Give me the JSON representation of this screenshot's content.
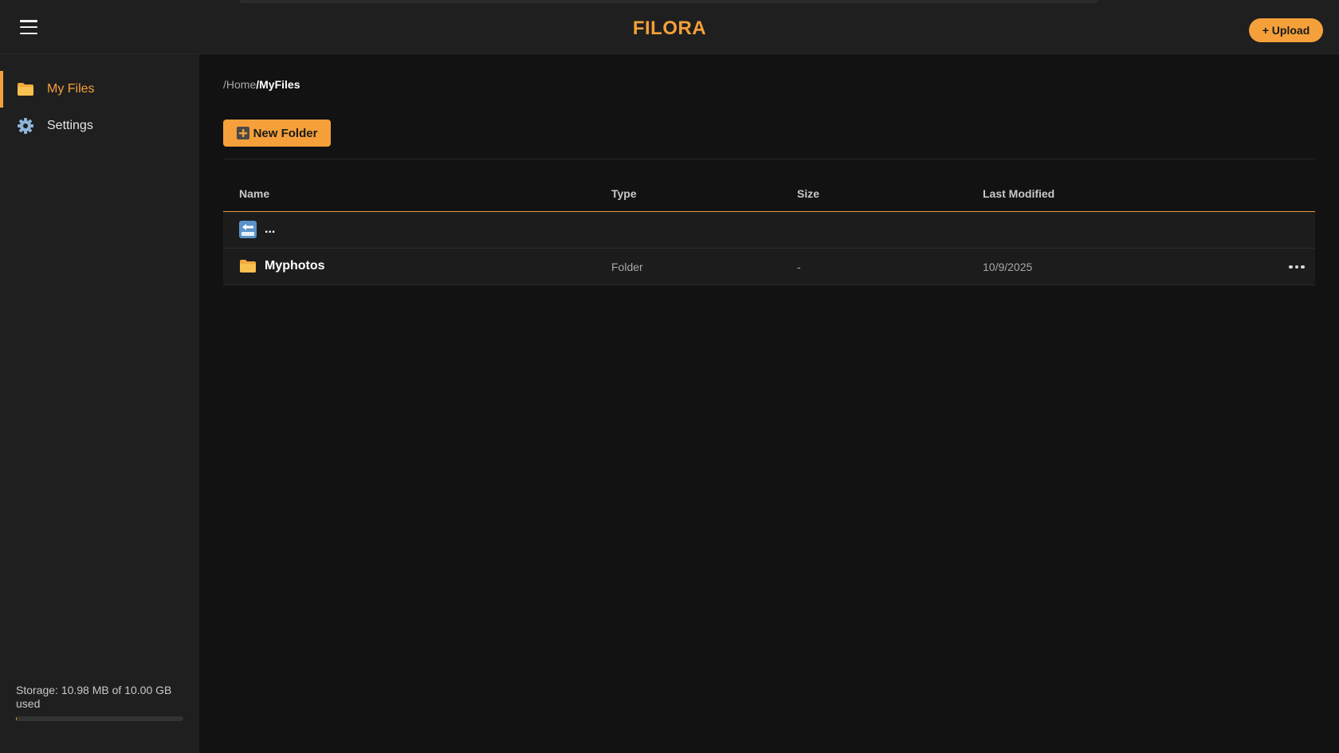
{
  "app": {
    "brand": "FILORA",
    "upload_label": "+ Upload"
  },
  "sidebar": {
    "items": [
      {
        "label": "My Files",
        "icon": "folder-icon",
        "active": true
      },
      {
        "label": "Settings",
        "icon": "gear-icon",
        "active": false
      }
    ],
    "storage": {
      "text": "Storage: 10.98 MB of 10.00 GB used",
      "used_fraction": 0.001
    }
  },
  "main": {
    "breadcrumb": {
      "home": "/Home",
      "current": "/MyFiles"
    },
    "new_folder_label": "New Folder",
    "table": {
      "columns": [
        "Name",
        "Type",
        "Size",
        "Last Modified"
      ],
      "back_row": {
        "icon": "back-arrow-icon",
        "name": "..."
      },
      "rows": [
        {
          "icon": "folder-icon",
          "name": "Myphotos",
          "type": "Folder",
          "size": "-",
          "modified": "10/9/2025"
        }
      ]
    }
  },
  "colors": {
    "accent": "#f5a03a",
    "background": "#121212",
    "panel": "#1f1f1f"
  }
}
